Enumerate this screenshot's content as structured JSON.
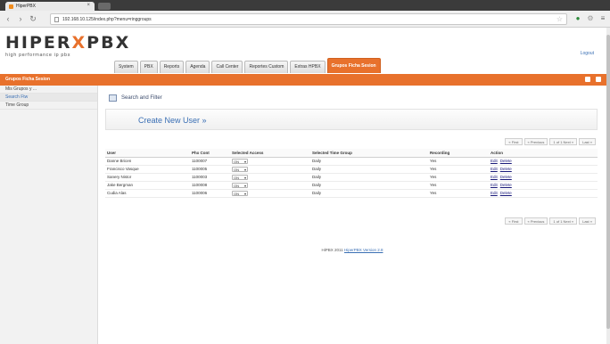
{
  "browser": {
    "tab_title": "HiperPBX",
    "url": "192.168.10.125/index.php?menu=ringgroups"
  },
  "app": {
    "logo_text_left": "HIPER",
    "logo_text_mid": "X",
    "logo_text_right": "PBX",
    "tagline": "high performance ip pbx",
    "logout": "Logout",
    "accent_color": "#e8712c"
  },
  "topnav": [
    {
      "label": "System"
    },
    {
      "label": "PBX"
    },
    {
      "label": "Reports"
    },
    {
      "label": "Agenda"
    },
    {
      "label": "Call Center"
    },
    {
      "label": "Reportes Custom"
    },
    {
      "label": "Extras HPBX"
    },
    {
      "label": "Grupos Ficha Sesion"
    }
  ],
  "orangebar": {
    "label": "Grupos Ficha Sesion"
  },
  "sidebar": {
    "items": [
      {
        "label": "Mis Grupos y ..."
      },
      {
        "label": "Search Ftw"
      },
      {
        "label": "Time Group"
      }
    ]
  },
  "main": {
    "panel_title": "Search and Filter",
    "create_link": "Create New User »",
    "pager": {
      "first": "« First",
      "prev": "« Previous",
      "range": "1 of 1 Next »",
      "last": "Last »"
    },
    "columns": [
      "User",
      "Phx Cont",
      "Selected Access",
      "Selected Time Group",
      "Recording",
      "Action"
    ],
    "rows": [
      {
        "user": "Danne Bricen",
        "ext": "1100007",
        "access": "ON",
        "time_group": "Daily",
        "recording": "Yes",
        "edit": "Edit",
        "delete": "Delete"
      },
      {
        "user": "Francisco Vasque",
        "ext": "1100005",
        "access": "ON",
        "time_group": "Daily",
        "recording": "Yes",
        "edit": "Edit",
        "delete": "Delete"
      },
      {
        "user": "Sanery Nistor",
        "ext": "1100003",
        "access": "ON",
        "time_group": "Daily",
        "recording": "Yes",
        "edit": "Edit",
        "delete": "Delete"
      },
      {
        "user": "Jake Bergman",
        "ext": "1100008",
        "access": "ON",
        "time_group": "Daily",
        "recording": "Yes",
        "edit": "Edit",
        "delete": "Delete"
      },
      {
        "user": "Cudia Alas",
        "ext": "1100006",
        "access": "ON",
        "time_group": "Daily",
        "recording": "Yes",
        "edit": "Edit",
        "delete": "Delete"
      }
    ],
    "footer_prefix": "HiPBX 2011 ",
    "footer_link": "HiperPBX Version 2.8"
  }
}
